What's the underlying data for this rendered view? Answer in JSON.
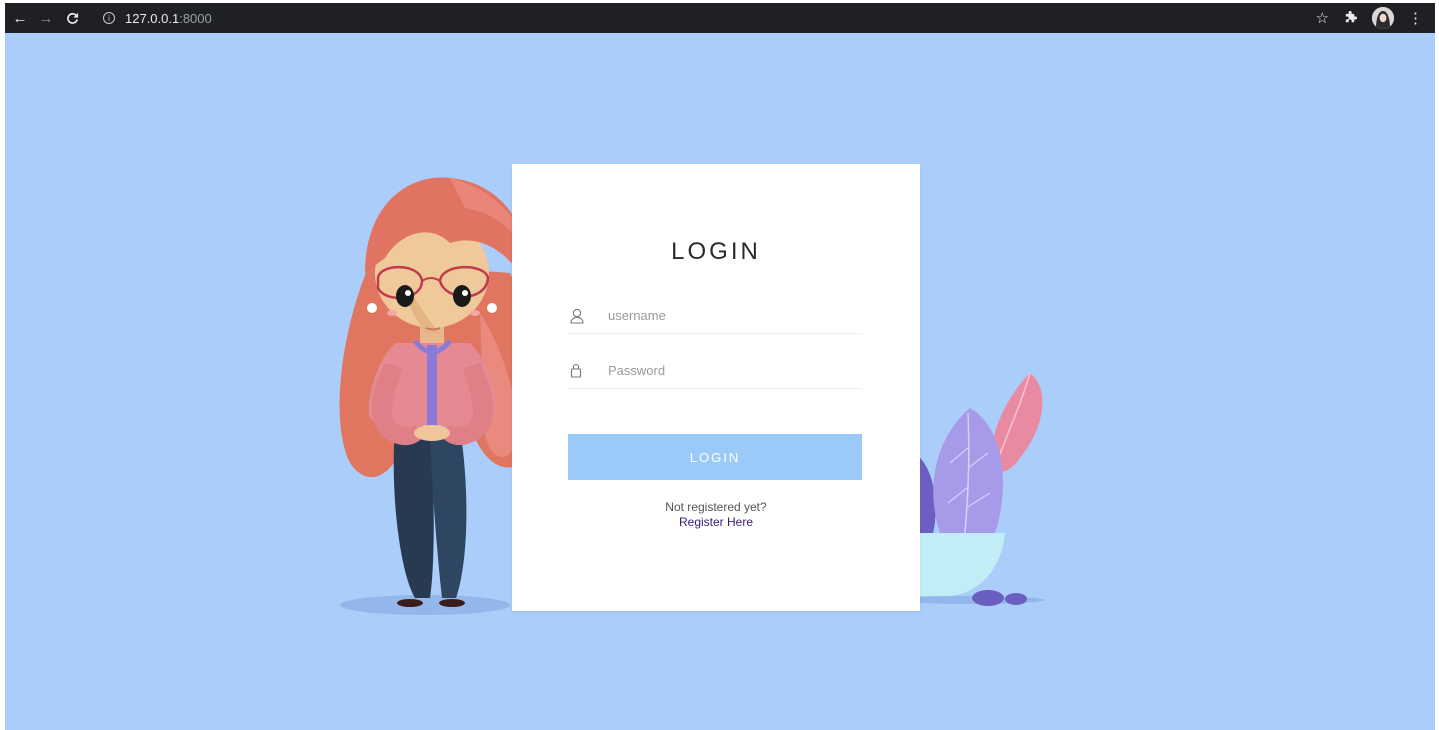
{
  "browser": {
    "url_host": "127.0.0.1",
    "url_port": ":8000",
    "icons": [
      "back-icon",
      "forward-icon",
      "reload-icon",
      "info-icon",
      "star-icon",
      "extensions-icon",
      "profile-avatar",
      "menu-icon"
    ]
  },
  "login_card": {
    "title": "LOGIN",
    "username_placeholder": "username",
    "password_placeholder": "Password",
    "button_label": "LOGIN",
    "register_prompt": "Not registered yet?",
    "register_link": "Register Here"
  },
  "colors": {
    "page_background": "#aacdf9",
    "button": "#9ccaf8",
    "link": "#3a1a6e"
  }
}
